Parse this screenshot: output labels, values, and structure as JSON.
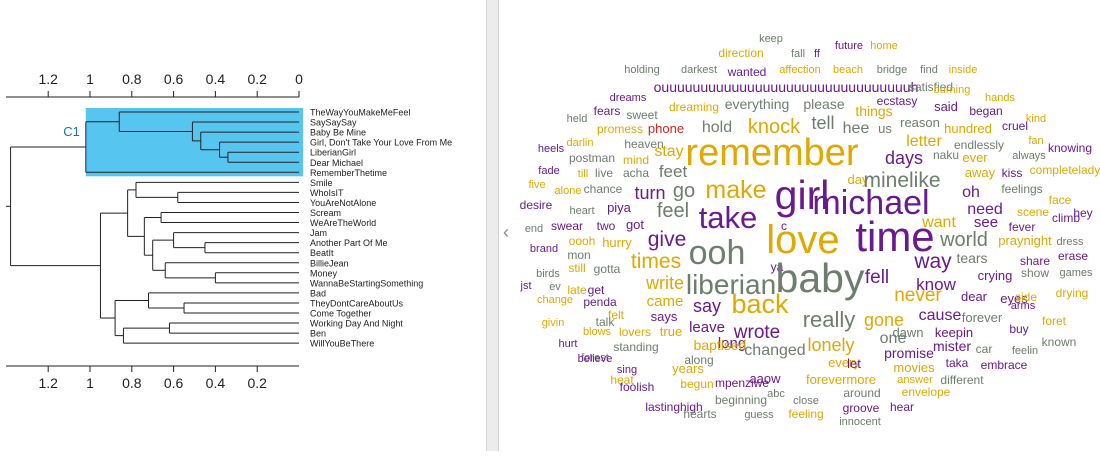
{
  "dendrogram": {
    "axis_ticks": [
      "1.2",
      "1",
      "0.8",
      "0.6",
      "0.4",
      "0.2",
      "0"
    ],
    "axis_ticks_bottom": [
      "1.2",
      "1",
      "0.8",
      "0.6",
      "0.4",
      "0.2"
    ],
    "cluster_label": "C1",
    "highlight_color": "#56c6f0",
    "leaves": [
      "TheWayYouMakeMeFeel",
      "SaySaySay",
      "Baby Be Mine",
      "Girl, Don't Take Your Love From Me",
      "LiberianGirl",
      "Dear Michael",
      "RememberThetime",
      "Smile",
      "WhoIsIT",
      "YouAreNotAlone",
      "Scream",
      "WeAreTheWorld",
      "Jam",
      "Another Part Of Me",
      "BeatIt",
      "BillieJean",
      "Money",
      "WannaBeStartingSomething",
      "Bad",
      "TheyDontCareAboutUs",
      "Come Together",
      "Working Day And Night",
      "Ben",
      "WillYouBeThere"
    ]
  },
  "panel": {
    "collapse_icon": "chevron-left-icon",
    "collapse_glyph": "‹"
  },
  "wordcloud": {
    "colors": {
      "gold": "#e0a800",
      "purple": "#6a1a8f",
      "gray": "#6e7d6e",
      "red": "#e0201a"
    },
    "words": [
      {
        "text": "keep",
        "color": "gray"
      },
      {
        "text": "direction",
        "color": "gold"
      },
      {
        "text": "fall",
        "color": "gray"
      },
      {
        "text": "ff",
        "color": "purple"
      },
      {
        "text": "future",
        "color": "purple"
      },
      {
        "text": "home",
        "color": "gold"
      },
      {
        "text": "holding",
        "color": "gray"
      },
      {
        "text": "darkest",
        "color": "gray"
      },
      {
        "text": "wanted",
        "color": "purple"
      },
      {
        "text": "affection",
        "color": "gold"
      },
      {
        "text": "beach",
        "color": "gold"
      },
      {
        "text": "bridge",
        "color": "gray"
      },
      {
        "text": "find",
        "color": "gray"
      },
      {
        "text": "inside",
        "color": "gold"
      },
      {
        "text": "ouuuuuuuuuuuuuuuuuuuuuuuuuuuuuuuuh",
        "color": "purple"
      },
      {
        "text": "satisfied",
        "color": "gray"
      },
      {
        "text": "burning",
        "color": "gold"
      },
      {
        "text": "dreams",
        "color": "purple"
      },
      {
        "text": "ecstasy",
        "color": "purple"
      },
      {
        "text": "hands",
        "color": "gold"
      },
      {
        "text": "fears",
        "color": "purple"
      },
      {
        "text": "sweet",
        "color": "gray"
      },
      {
        "text": "dreaming",
        "color": "gold"
      },
      {
        "text": "everything",
        "color": "gray"
      },
      {
        "text": "please",
        "color": "gray"
      },
      {
        "text": "things",
        "color": "gold"
      },
      {
        "text": "said",
        "color": "purple"
      },
      {
        "text": "began",
        "color": "purple"
      },
      {
        "text": "held",
        "color": "gray"
      },
      {
        "text": "reason",
        "color": "gray"
      },
      {
        "text": "kind",
        "color": "gold"
      },
      {
        "text": "promess",
        "color": "gold"
      },
      {
        "text": "phone",
        "color": "red"
      },
      {
        "text": "hold",
        "color": "gray"
      },
      {
        "text": "knock",
        "color": "gold"
      },
      {
        "text": "tell",
        "color": "gray"
      },
      {
        "text": "hee",
        "color": "gray"
      },
      {
        "text": "us",
        "color": "gray"
      },
      {
        "text": "hundred",
        "color": "gold"
      },
      {
        "text": "cruel",
        "color": "purple"
      },
      {
        "text": "darlin",
        "color": "gold"
      },
      {
        "text": "heaven",
        "color": "gray"
      },
      {
        "text": "letter",
        "color": "gold"
      },
      {
        "text": "fan",
        "color": "gold"
      },
      {
        "text": "heels",
        "color": "purple"
      },
      {
        "text": "endlessly",
        "color": "gray"
      },
      {
        "text": "always",
        "color": "gray"
      },
      {
        "text": "knowing",
        "color": "purple"
      },
      {
        "text": "stay",
        "color": "gold"
      },
      {
        "text": "remember",
        "color": "gold"
      },
      {
        "text": "ever",
        "color": "gold"
      },
      {
        "text": "postman",
        "color": "gray"
      },
      {
        "text": "mind",
        "color": "gold"
      },
      {
        "text": "days",
        "color": "purple"
      },
      {
        "text": "naku",
        "color": "gray"
      },
      {
        "text": "fade",
        "color": "purple"
      },
      {
        "text": "till",
        "color": "gold"
      },
      {
        "text": "live",
        "color": "gray"
      },
      {
        "text": "acha",
        "color": "gray"
      },
      {
        "text": "feet",
        "color": "gray"
      },
      {
        "text": "away",
        "color": "gold"
      },
      {
        "text": "kiss",
        "color": "purple"
      },
      {
        "text": "completelady",
        "color": "gold"
      },
      {
        "text": "five",
        "color": "gold"
      },
      {
        "text": "alone",
        "color": "gold"
      },
      {
        "text": "chance",
        "color": "gray"
      },
      {
        "text": "day",
        "color": "gold"
      },
      {
        "text": "minelike",
        "color": "gray"
      },
      {
        "text": "feelings",
        "color": "gray"
      },
      {
        "text": "turn",
        "color": "purple"
      },
      {
        "text": "go",
        "color": "gray"
      },
      {
        "text": "make",
        "color": "gold"
      },
      {
        "text": "girl",
        "color": "purple"
      },
      {
        "text": "oh",
        "color": "purple"
      },
      {
        "text": "face",
        "color": "gold"
      },
      {
        "text": "desire",
        "color": "purple"
      },
      {
        "text": "heart",
        "color": "gray"
      },
      {
        "text": "piya",
        "color": "purple"
      },
      {
        "text": "michael",
        "color": "purple"
      },
      {
        "text": "need",
        "color": "purple"
      },
      {
        "text": "scene",
        "color": "gold"
      },
      {
        "text": "hey",
        "color": "purple"
      },
      {
        "text": "feel",
        "color": "gray"
      },
      {
        "text": "take",
        "color": "purple"
      },
      {
        "text": "want",
        "color": "gold"
      },
      {
        "text": "see",
        "color": "purple"
      },
      {
        "text": "climb",
        "color": "purple"
      },
      {
        "text": "end",
        "color": "gray"
      },
      {
        "text": "swear",
        "color": "purple"
      },
      {
        "text": "two",
        "color": "purple"
      },
      {
        "text": "got",
        "color": "purple"
      },
      {
        "text": "c",
        "color": "purple"
      },
      {
        "text": "fever",
        "color": "purple"
      },
      {
        "text": "give",
        "color": "purple"
      },
      {
        "text": "love",
        "color": "gold"
      },
      {
        "text": "time",
        "color": "purple"
      },
      {
        "text": "world",
        "color": "gray"
      },
      {
        "text": "praynight",
        "color": "gold"
      },
      {
        "text": "dress",
        "color": "gray"
      },
      {
        "text": "brand",
        "color": "purple"
      },
      {
        "text": "oooh",
        "color": "gold"
      },
      {
        "text": "hurry",
        "color": "gold"
      },
      {
        "text": "mon",
        "color": "gray"
      },
      {
        "text": "ooh",
        "color": "gray"
      },
      {
        "text": "tears",
        "color": "gray"
      },
      {
        "text": "erase",
        "color": "purple"
      },
      {
        "text": "still",
        "color": "gold"
      },
      {
        "text": "gotta",
        "color": "gray"
      },
      {
        "text": "times",
        "color": "gold"
      },
      {
        "text": "way",
        "color": "purple"
      },
      {
        "text": "share",
        "color": "purple"
      },
      {
        "text": "birds",
        "color": "gray"
      },
      {
        "text": "liberian",
        "color": "gray"
      },
      {
        "text": "ya",
        "color": "purple"
      },
      {
        "text": "crying",
        "color": "purple"
      },
      {
        "text": "show",
        "color": "gray"
      },
      {
        "text": "games",
        "color": "gray"
      },
      {
        "text": "jst",
        "color": "purple"
      },
      {
        "text": "ev",
        "color": "gray"
      },
      {
        "text": "baby",
        "color": "gray"
      },
      {
        "text": "fell",
        "color": "purple"
      },
      {
        "text": "know",
        "color": "purple"
      },
      {
        "text": "write",
        "color": "gold"
      },
      {
        "text": "late",
        "color": "gold"
      },
      {
        "text": "get",
        "color": "purple"
      },
      {
        "text": "drying",
        "color": "gold"
      },
      {
        "text": "change",
        "color": "gold"
      },
      {
        "text": "never",
        "color": "gold"
      },
      {
        "text": "dear",
        "color": "purple"
      },
      {
        "text": "eyes",
        "color": "purple"
      },
      {
        "text": "side",
        "color": "gold"
      },
      {
        "text": "arms",
        "color": "purple"
      },
      {
        "text": "penda",
        "color": "purple"
      },
      {
        "text": "came",
        "color": "gold"
      },
      {
        "text": "say",
        "color": "purple"
      },
      {
        "text": "back",
        "color": "gold"
      },
      {
        "text": "foret",
        "color": "gold"
      },
      {
        "text": "felt",
        "color": "gold"
      },
      {
        "text": "says",
        "color": "purple"
      },
      {
        "text": "cause",
        "color": "purple"
      },
      {
        "text": "forever",
        "color": "gray"
      },
      {
        "text": "givin",
        "color": "gold"
      },
      {
        "text": "talk",
        "color": "gray"
      },
      {
        "text": "really",
        "color": "gray"
      },
      {
        "text": "gone",
        "color": "gold"
      },
      {
        "text": "buy",
        "color": "purple"
      },
      {
        "text": "blows",
        "color": "gold"
      },
      {
        "text": "lovers",
        "color": "gold"
      },
      {
        "text": "true",
        "color": "gold"
      },
      {
        "text": "leave",
        "color": "purple"
      },
      {
        "text": "wrote",
        "color": "purple"
      },
      {
        "text": "dawn",
        "color": "gray"
      },
      {
        "text": "keepin",
        "color": "purple"
      },
      {
        "text": "hurt",
        "color": "purple"
      },
      {
        "text": "long",
        "color": "purple"
      },
      {
        "text": "one",
        "color": "gray"
      },
      {
        "text": "known",
        "color": "gray"
      },
      {
        "text": "standing",
        "color": "gray"
      },
      {
        "text": "baptised",
        "color": "gold"
      },
      {
        "text": "lonely",
        "color": "gold"
      },
      {
        "text": "mister",
        "color": "purple"
      },
      {
        "text": "car",
        "color": "gray"
      },
      {
        "text": "feelin",
        "color": "gray"
      },
      {
        "text": "forest",
        "color": "gray"
      },
      {
        "text": "changed",
        "color": "gray"
      },
      {
        "text": "promise",
        "color": "purple"
      },
      {
        "text": "taka",
        "color": "purple"
      },
      {
        "text": "believe",
        "color": "purple"
      },
      {
        "text": "along",
        "color": "gray"
      },
      {
        "text": "every",
        "color": "gold"
      },
      {
        "text": "embrace",
        "color": "purple"
      },
      {
        "text": "sing",
        "color": "purple"
      },
      {
        "text": "years",
        "color": "gold"
      },
      {
        "text": "let",
        "color": "purple"
      },
      {
        "text": "movies",
        "color": "gold"
      },
      {
        "text": "heat",
        "color": "gold"
      },
      {
        "text": "mpenziwe",
        "color": "purple"
      },
      {
        "text": "aaow",
        "color": "purple"
      },
      {
        "text": "forevermore",
        "color": "gold"
      },
      {
        "text": "answer",
        "color": "gold"
      },
      {
        "text": "different",
        "color": "gray"
      },
      {
        "text": "foolish",
        "color": "purple"
      },
      {
        "text": "begun",
        "color": "gold"
      },
      {
        "text": "abc",
        "color": "gray"
      },
      {
        "text": "around",
        "color": "gray"
      },
      {
        "text": "envelope",
        "color": "gold"
      },
      {
        "text": "lastinghigh",
        "color": "purple"
      },
      {
        "text": "beginning",
        "color": "gray"
      },
      {
        "text": "close",
        "color": "gray"
      },
      {
        "text": "groove",
        "color": "purple"
      },
      {
        "text": "hear",
        "color": "purple"
      },
      {
        "text": "hearts",
        "color": "gray"
      },
      {
        "text": "guess",
        "color": "gray"
      },
      {
        "text": "feeling",
        "color": "gold"
      },
      {
        "text": "innocent",
        "color": "gray"
      }
    ]
  }
}
